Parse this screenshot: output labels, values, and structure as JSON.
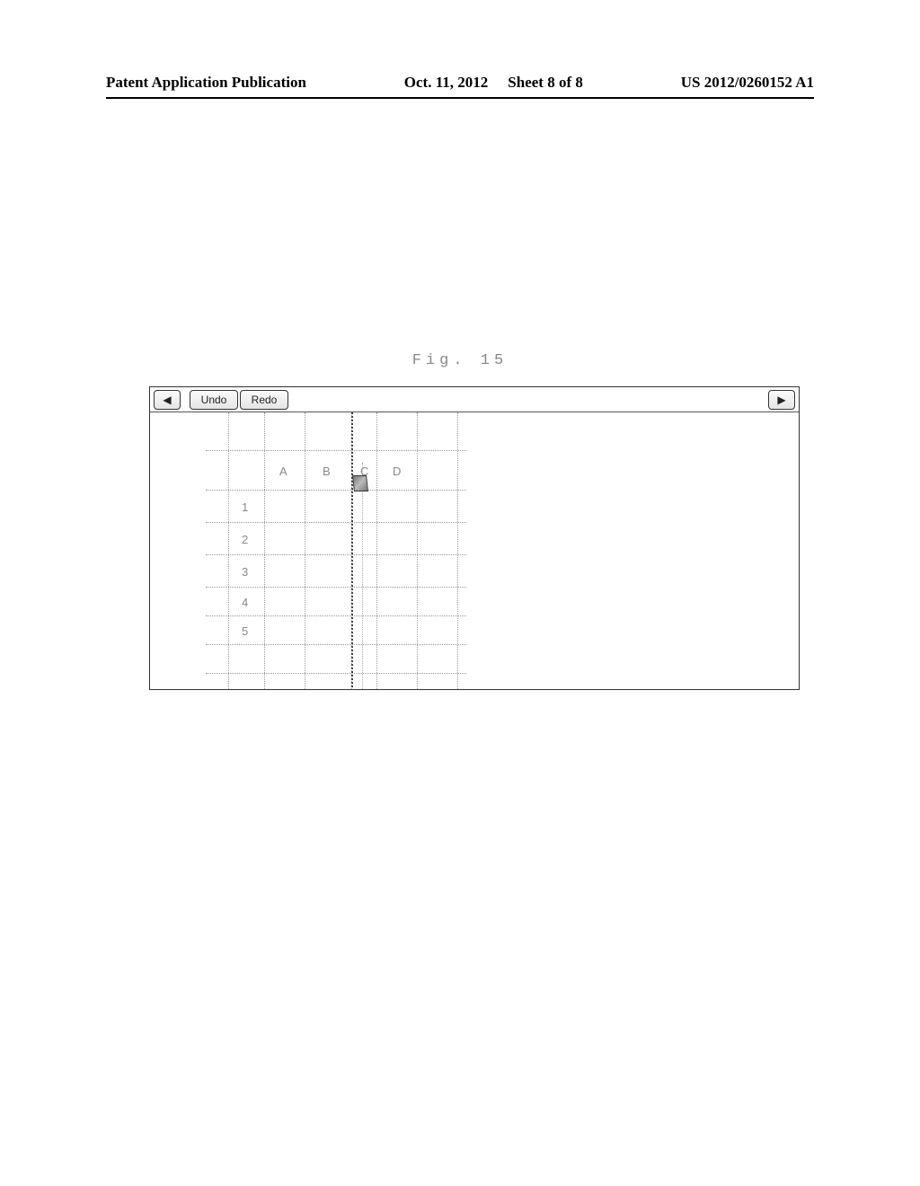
{
  "header": {
    "pubtype": "Patent Application Publication",
    "date": "Oct. 11, 2012",
    "sheet": "Sheet 8 of 8",
    "pubnum": "US 2012/0260152 A1"
  },
  "figure": {
    "label": "Fig. 15"
  },
  "toolbar": {
    "back_icon": "◀",
    "undo_label": "Undo",
    "redo_label": "Redo",
    "fwd_icon": "▶"
  },
  "spreadsheet": {
    "cols": [
      "A",
      "B",
      "C",
      "D"
    ],
    "rows": [
      "1",
      "2",
      "3",
      "4",
      "5"
    ]
  }
}
